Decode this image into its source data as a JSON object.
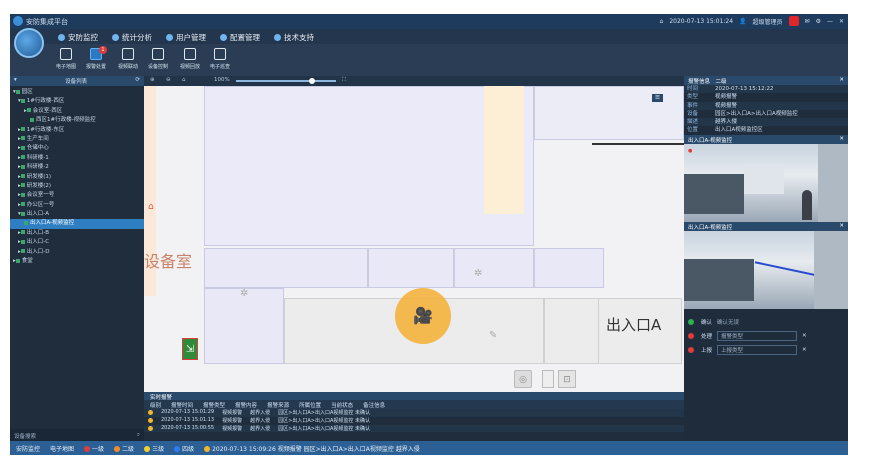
{
  "titlebar": {
    "title": "安防集成平台",
    "datetime": "2020-07-13 15:01:24",
    "user": "超级管理员"
  },
  "menu": [
    {
      "label": "安防监控"
    },
    {
      "label": "统计分析"
    },
    {
      "label": "用户管理"
    },
    {
      "label": "配置管理"
    },
    {
      "label": "技术支持"
    }
  ],
  "toolbar": {
    "items": [
      {
        "label": "电子地图"
      },
      {
        "label": "报警处置",
        "badge": "1"
      },
      {
        "label": "视频联动"
      },
      {
        "label": "设备控制"
      },
      {
        "label": "视频回放"
      },
      {
        "label": "电子巡查"
      }
    ]
  },
  "left": {
    "header": "设备列表",
    "tree": [
      "园区",
      "1#行政楼-西区",
      "会议室-西区",
      "西区1#行政楼-视频监控",
      "1#行政楼-东区",
      "生产车间",
      "仓储中心",
      "科研楼-1",
      "科研楼-2",
      "研发楼(1)",
      "研发楼(2)",
      "会议室一号",
      "办公区一号",
      "出入口-A",
      "出入口A-视频监控",
      "出入口-B",
      "出入口-C",
      "出入口-D",
      "食堂"
    ],
    "footer": "设备搜索"
  },
  "map": {
    "zoom": "100%",
    "label_room": "设备室",
    "label_exit": "出入口A"
  },
  "right": {
    "alarm_header": "报警信息",
    "alarm_level": "二级",
    "fields": [
      {
        "k": "时间",
        "v": "2020-07-13 15:12:22"
      },
      {
        "k": "类型",
        "v": "视频报警"
      },
      {
        "k": "事件",
        "v": "视频报警"
      },
      {
        "k": "设备",
        "v": "园区>出入口A>出入口A视频监控"
      },
      {
        "k": "描述",
        "v": "越界入侵"
      },
      {
        "k": "位置",
        "v": "出入口A视频监控区"
      }
    ],
    "video1_title": "出入口A-视频监控",
    "video2_title": "出入口A-视频监控",
    "actions": [
      {
        "label": "确认",
        "value": "确认无误"
      },
      {
        "label": "处理",
        "value": "报警类型"
      },
      {
        "label": "上报",
        "value": "上报类型"
      }
    ]
  },
  "bottom": {
    "title": "实时报警",
    "columns": [
      "级别",
      "报警时间",
      "报警类型",
      "报警内容",
      "报警来源",
      "所属位置",
      "当前状态",
      "备注信息"
    ],
    "rows": [
      [
        "2020-07-13 15:01:29",
        "视频报警",
        "越界入侵",
        "园区>出入口A>出入口A视频监控 未确认"
      ],
      [
        "2020-07-13 15:01:13",
        "视频报警",
        "越界入侵",
        "园区>出入口A>出入口A视频监控 未确认"
      ],
      [
        "2020-07-13 15:00:55",
        "视频报警",
        "越界入侵",
        "园区>出入口A>出入口A视频监控 未确认"
      ]
    ]
  },
  "status": {
    "system": "安防监控",
    "map": "电子地图",
    "legend": [
      "一级",
      "二级",
      "三级",
      "四级"
    ],
    "ticker": "2020-07-13 15:09:26 视频报警 园区>出入口A>出入口A视频监控 越界入侵"
  }
}
